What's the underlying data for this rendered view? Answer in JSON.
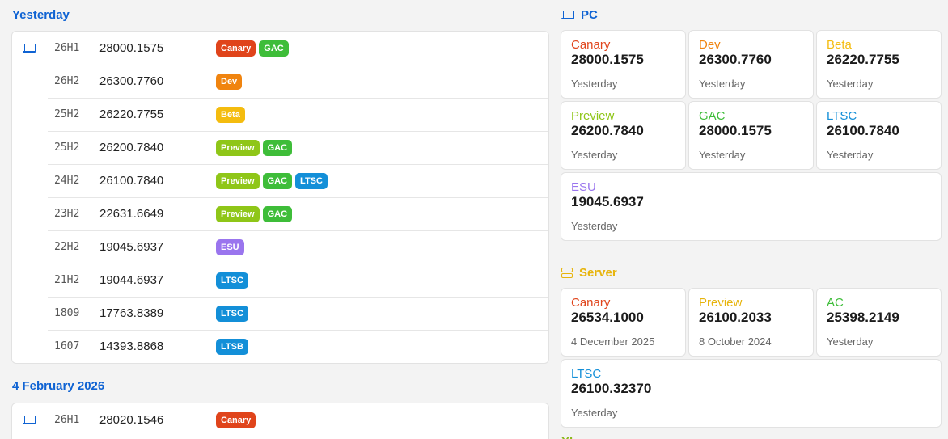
{
  "colors": {
    "canary": "#e0441b",
    "dev": "#f0840f",
    "beta": "#f4bc0f",
    "preview": "#8fc618",
    "gac": "#3ebd39",
    "ltsc": "#138fd8",
    "esu": "#9a75ee",
    "ltsb": "#138fd8",
    "heading_blue": "#0f63d3",
    "server_yellow": "#e7b40c"
  },
  "groups": [
    {
      "date": "Yesterday",
      "icon": "laptop-icon",
      "rows": [
        {
          "version": "26H1",
          "build": "28000.1575",
          "tags": [
            "Canary",
            "GAC"
          ]
        },
        {
          "version": "26H2",
          "build": "26300.7760",
          "tags": [
            "Dev"
          ]
        },
        {
          "version": "25H2",
          "build": "26220.7755",
          "tags": [
            "Beta"
          ]
        },
        {
          "version": "25H2",
          "build": "26200.7840",
          "tags": [
            "Preview",
            "GAC"
          ]
        },
        {
          "version": "24H2",
          "build": "26100.7840",
          "tags": [
            "Preview",
            "GAC",
            "LTSC"
          ]
        },
        {
          "version": "23H2",
          "build": "22631.6649",
          "tags": [
            "Preview",
            "GAC"
          ]
        },
        {
          "version": "22H2",
          "build": "19045.6937",
          "tags": [
            "ESU"
          ]
        },
        {
          "version": "21H2",
          "build": "19044.6937",
          "tags": [
            "LTSC"
          ]
        },
        {
          "version": "1809",
          "build": "17763.8389",
          "tags": [
            "LTSC"
          ]
        },
        {
          "version": "1607",
          "build": "14393.8868",
          "tags": [
            "LTSB"
          ]
        }
      ]
    },
    {
      "date": "4 February 2026",
      "icon": "laptop-icon",
      "rows": [
        {
          "version": "26H1",
          "build": "28020.1546",
          "tags": [
            "Canary"
          ]
        }
      ]
    }
  ],
  "pc": {
    "title": "PC",
    "tiles": [
      {
        "channel": "Canary",
        "build": "28000.1575",
        "date": "Yesterday"
      },
      {
        "channel": "Dev",
        "build": "26300.7760",
        "date": "Yesterday"
      },
      {
        "channel": "Beta",
        "build": "26220.7755",
        "date": "Yesterday"
      },
      {
        "channel": "Preview",
        "build": "26200.7840",
        "date": "Yesterday"
      },
      {
        "channel": "GAC",
        "build": "28000.1575",
        "date": "Yesterday"
      },
      {
        "channel": "LTSC",
        "build": "26100.7840",
        "date": "Yesterday"
      },
      {
        "channel": "ESU",
        "build": "19045.6937",
        "date": "Yesterday"
      }
    ]
  },
  "server": {
    "title": "Server",
    "tiles": [
      {
        "channel": "Canary",
        "build": "26534.1000",
        "date": "4 December 2025"
      },
      {
        "channel": "Preview",
        "build": "26100.2033",
        "date": "8 October 2024"
      },
      {
        "channel": "AC",
        "build": "25398.2149",
        "date": "Yesterday"
      },
      {
        "channel": "LTSC",
        "build": "26100.32370",
        "date": "Yesterday"
      }
    ]
  },
  "next_section_partial": "Xb"
}
